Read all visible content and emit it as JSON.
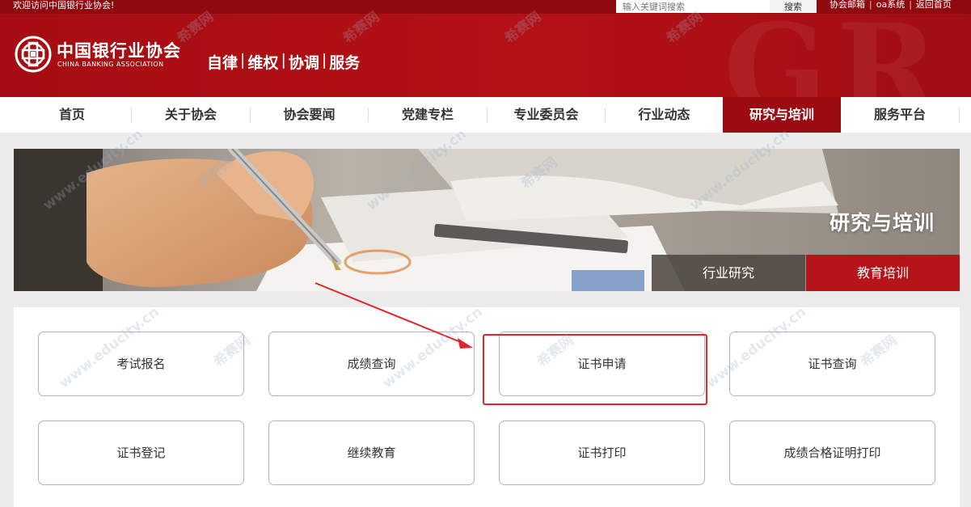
{
  "topbar": {
    "welcome": "欢迎访问中国银行业协会!",
    "search_placeholder": "输入关键词搜索",
    "search_button": "搜索",
    "links": [
      "协会邮箱",
      "oa系统",
      "返回首页"
    ]
  },
  "header": {
    "logo_cn": "中国银行业协会",
    "logo_en": "CHINA BANKING ASSOCIATION",
    "slogan": [
      "自律",
      "维权",
      "协调",
      "服务"
    ],
    "slogan_separator": "|"
  },
  "nav": {
    "items": [
      "首页",
      "关于协会",
      "协会要闻",
      "党建专栏",
      "专业委员会",
      "行业动态",
      "研究与培训",
      "服务平台"
    ],
    "active": "研究与培训"
  },
  "banner": {
    "title": "研究与培训",
    "tabs": [
      "行业研究",
      "教育培训"
    ],
    "active_tab": "教育培训"
  },
  "options": [
    "考试报名",
    "成绩查询",
    "证书申请",
    "证书查询",
    "证书登记",
    "继续教育",
    "证书打印",
    "成绩合格证明打印"
  ],
  "highlighted_option": "证书申请",
  "watermark": {
    "text_cn": "希赛网",
    "text_url": "www.educity.cn"
  },
  "colors": {
    "brand_red": "#b41116",
    "dark_red": "#8e0a0e",
    "nav_active": "#9c0b12",
    "highlight": "#e3242b"
  }
}
